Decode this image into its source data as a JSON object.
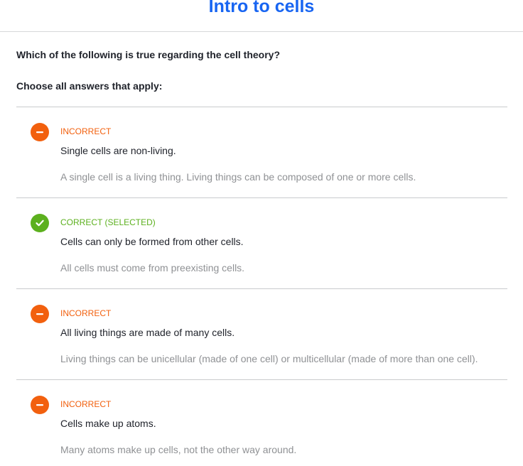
{
  "header": {
    "title": "Intro to cells"
  },
  "question": {
    "prompt": "Which of the following is true regarding the cell theory?",
    "instruction": "Choose all answers that apply:"
  },
  "colors": {
    "title_blue": "#1865f2",
    "incorrect_orange": "#f2600e",
    "correct_green": "#5cb01e",
    "explanation_gray": "#8f9194"
  },
  "choices": [
    {
      "status": "INCORRECT",
      "status_icon": "minus-icon",
      "answer": "Single cells are non-living.",
      "explanation": "A single cell is a living thing. Living things can be composed of one or more cells."
    },
    {
      "status": "CORRECT (SELECTED)",
      "status_icon": "check-icon",
      "answer": "Cells can only be formed from other cells.",
      "explanation": "All cells must come from preexisting cells."
    },
    {
      "status": "INCORRECT",
      "status_icon": "minus-icon",
      "answer": "All living things are made of many cells.",
      "explanation": "Living things can be unicellular (made of one cell) or multicellular (made of more than one cell)."
    },
    {
      "status": "INCORRECT",
      "status_icon": "minus-icon",
      "answer": "Cells make up atoms.",
      "explanation": "Many atoms make up cells, not the other way around."
    }
  ]
}
